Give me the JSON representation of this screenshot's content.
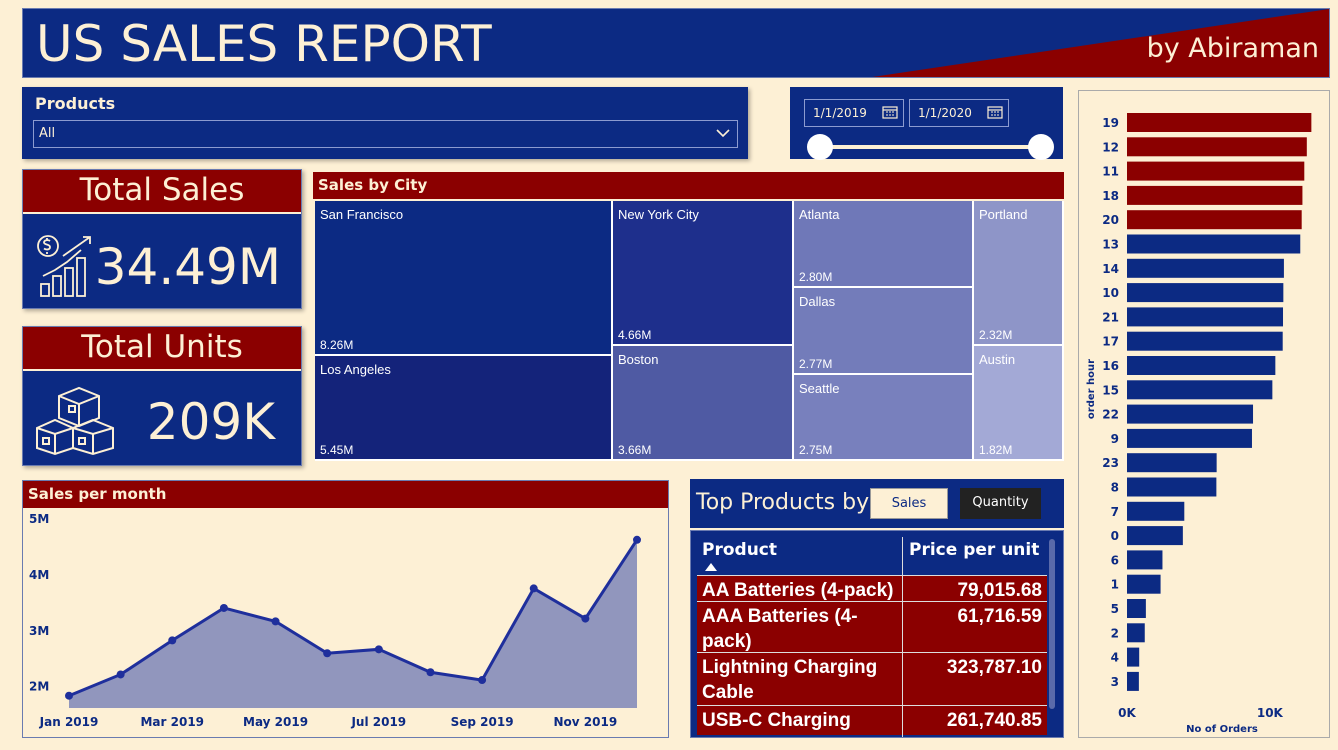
{
  "header": {
    "title": "US SALES REPORT",
    "author": "by Abiraman"
  },
  "products_slicer": {
    "label": "Products",
    "value": "All"
  },
  "date_slicer": {
    "start": "1/1/2019",
    "end": "1/1/2020"
  },
  "kpis": {
    "sales": {
      "title": "Total Sales",
      "value": "34.49M",
      "icon": "money-growth-icon"
    },
    "units": {
      "title": "Total Units",
      "value": "209K",
      "icon": "boxes-icon"
    }
  },
  "sales_by_city": {
    "title": "Sales by City",
    "cities": [
      {
        "name": "San Francisco",
        "value": "8.26M",
        "color": "#0c2a83"
      },
      {
        "name": "Los Angeles",
        "value": "5.45M",
        "color": "#14237a"
      },
      {
        "name": "New York City",
        "value": "4.66M",
        "color": "#1e2f8c"
      },
      {
        "name": "Boston",
        "value": "3.66M",
        "color": "#4f5aa3"
      },
      {
        "name": "Atlanta",
        "value": "2.80M",
        "color": "#6f78b8"
      },
      {
        "name": "Dallas",
        "value": "2.77M",
        "color": "#737cba"
      },
      {
        "name": "Seattle",
        "value": "2.75M",
        "color": "#7880bd"
      },
      {
        "name": "Portland",
        "value": "2.32M",
        "color": "#8e95c8"
      },
      {
        "name": "Austin",
        "value": "1.82M",
        "color": "#a3a9d6"
      }
    ]
  },
  "sales_per_month": {
    "title": "Sales per month"
  },
  "top_products": {
    "title": "Top Products by",
    "buttons": {
      "sales": "Sales",
      "quantity": "Quantity"
    },
    "columns": {
      "product": "Product",
      "price": "Price per unit"
    },
    "rows": [
      {
        "product": "AA Batteries (4-pack)",
        "price": "79,015.68"
      },
      {
        "product": "AAA Batteries (4-pack)",
        "price": "61,716.59"
      },
      {
        "product": "Lightning Charging Cable",
        "price": "323,787.10"
      },
      {
        "product": "USB-C Charging",
        "price": "261,740.85"
      }
    ]
  },
  "chart_data": [
    {
      "type": "area",
      "title": "Sales per month",
      "x": [
        "Jan 2019",
        "Feb 2019",
        "Mar 2019",
        "Apr 2019",
        "May 2019",
        "Jun 2019",
        "Jul 2019",
        "Aug 2019",
        "Sep 2019",
        "Oct 2019",
        "Nov 2019",
        "Dec 2019"
      ],
      "x_tick_labels": [
        "Jan 2019",
        "Mar 2019",
        "May 2019",
        "Jul 2019",
        "Sep 2019",
        "Nov 2019"
      ],
      "values": [
        1.82,
        2.2,
        2.81,
        3.39,
        3.15,
        2.58,
        2.65,
        2.24,
        2.1,
        3.74,
        3.2,
        4.61
      ],
      "y_ticks": [
        "2M",
        "3M",
        "4M",
        "5M"
      ],
      "ylim": [
        1.6,
        5.0
      ],
      "color": "#1f2f9c",
      "fill": "#9196bd"
    },
    {
      "type": "bar",
      "orientation": "horizontal",
      "xlabel": "No of Orders",
      "ylabel": "order hour",
      "x_ticks": [
        "0K",
        "10K"
      ],
      "xlim": [
        0,
        14000
      ],
      "categories": [
        "19",
        "12",
        "11",
        "18",
        "20",
        "13",
        "14",
        "10",
        "21",
        "17",
        "16",
        "15",
        "22",
        "9",
        "23",
        "8",
        "7",
        "0",
        "6",
        "1",
        "5",
        "2",
        "4",
        "3"
      ],
      "values": [
        12905,
        12587,
        12411,
        12280,
        12228,
        12129,
        10984,
        10944,
        10921,
        10899,
        10384,
        10175,
        8822,
        8748,
        6275,
        6256,
        4011,
        3910,
        2482,
        2350,
        1321,
        1243,
        854,
        831
      ],
      "highlight_count": 5,
      "highlight_color": "#8b0000",
      "bar_color": "#0c2a83"
    }
  ]
}
